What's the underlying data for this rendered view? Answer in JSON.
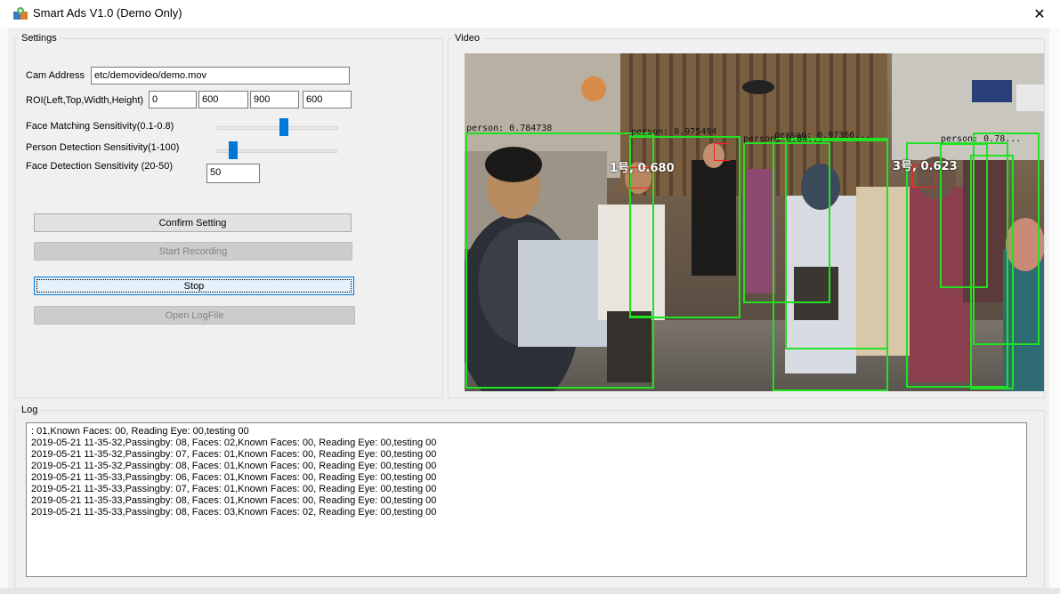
{
  "window": {
    "title": "Smart Ads V1.0 (Demo Only)",
    "close_glyph": "✕"
  },
  "settings": {
    "legend": "Settings",
    "cam_address_label": "Cam Address",
    "cam_address_value": "etc/demovideo/demo.mov",
    "roi_label": "ROI(Left,Top,Width,Height)",
    "roi_values": [
      "0",
      "600",
      "900",
      "600"
    ],
    "face_matching_label": "Face Matching Sensitivity(0.1-0.8)",
    "face_matching_level": 0.55,
    "person_detection_label": "Person Detection Sensitivity(1-100)",
    "person_detection_level": 0.1,
    "face_detection_label": "Face Detection Sensitivity (20-50)",
    "face_detection_value": "50",
    "confirm_label": "Confirm Setting",
    "start_label": "Start Recording",
    "stop_label": "Stop",
    "open_log_label": "Open LogFile"
  },
  "video": {
    "legend": "Video",
    "detections": [
      {
        "text": "person: 0.784738"
      },
      {
        "text": "person: 0.975494"
      },
      {
        "text": "person: 0.84..."
      },
      {
        "text": "person: 0.97366..."
      },
      {
        "text": "person: 0.78..."
      }
    ],
    "face_labels": [
      {
        "text": "1号, 0.680"
      },
      {
        "text": "3号, 0.623"
      }
    ]
  },
  "log": {
    "legend": "Log",
    "lines": [
      ": 01,Known Faces: 00, Reading Eye: 00,testing  00",
      "2019-05-21 11-35-32,Passingby: 08, Faces: 02,Known Faces: 00, Reading Eye: 00,testing  00",
      "2019-05-21 11-35-32,Passingby: 07, Faces: 01,Known Faces: 00, Reading Eye: 00,testing  00",
      "2019-05-21 11-35-32,Passingby: 08, Faces: 01,Known Faces: 00, Reading Eye: 00,testing  00",
      "2019-05-21 11-35-33,Passingby: 06, Faces: 01,Known Faces: 00, Reading Eye: 00,testing  00",
      "2019-05-21 11-35-33,Passingby: 07, Faces: 01,Known Faces: 00, Reading Eye: 00,testing  00",
      "2019-05-21 11-35-33,Passingby: 08, Faces: 01,Known Faces: 00, Reading Eye: 00,testing  00",
      "2019-05-21 11-35-33,Passingby: 08, Faces: 03,Known Faces: 02, Reading Eye: 00,testing  00"
    ]
  },
  "colors": {
    "accent": "#0078d7",
    "detection_box": "#22e022",
    "face_box": "#ff2020"
  }
}
